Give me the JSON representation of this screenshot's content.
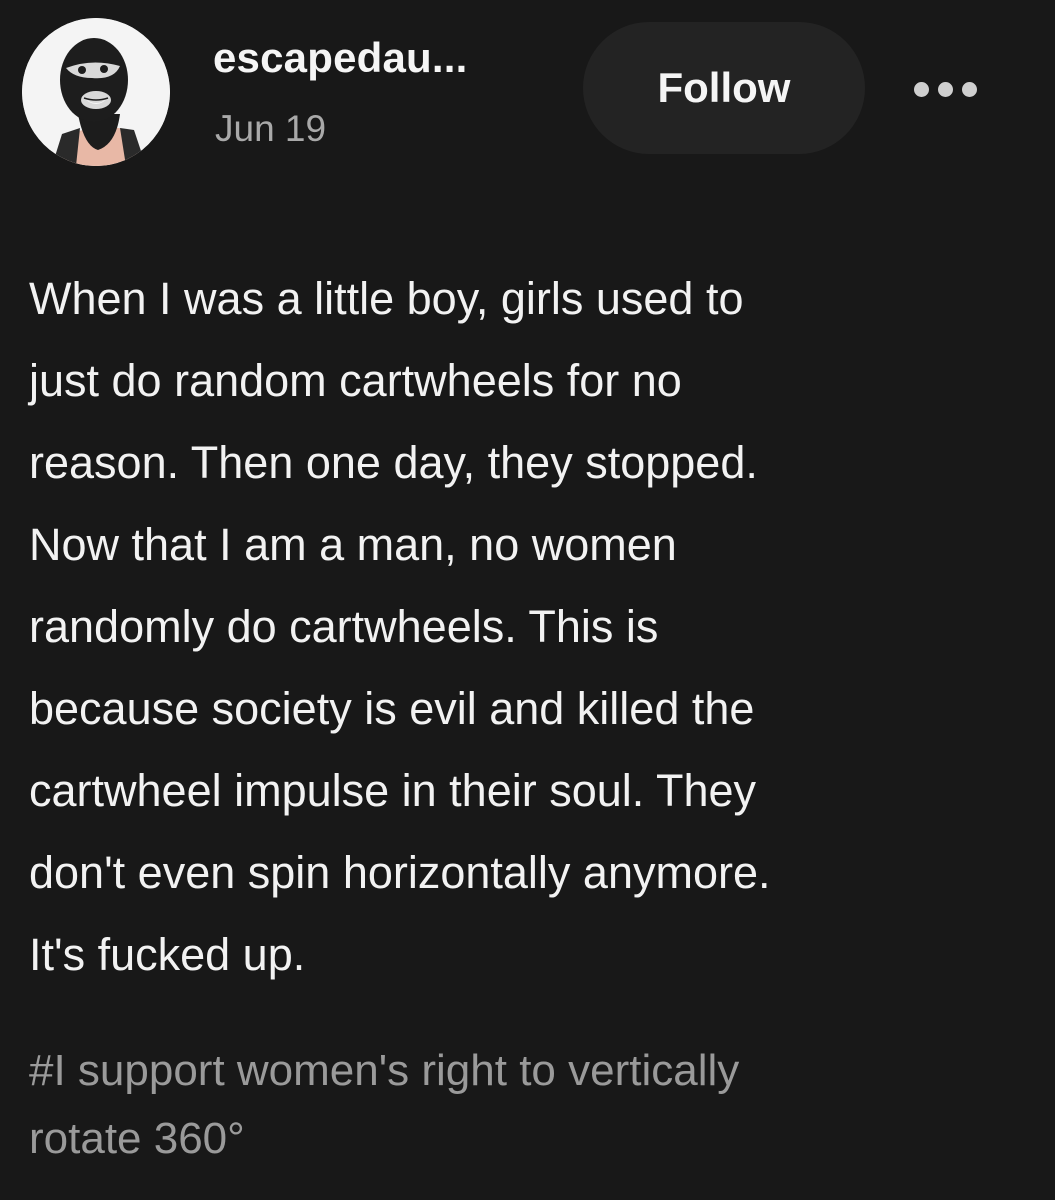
{
  "post": {
    "username": "escapedau...",
    "date": "Jun 19",
    "follow_label": "Follow",
    "body_lines": [
      "When I was a little boy, girls used to",
      "just do random cartwheels for no",
      "reason. Then one day, they stopped.",
      "Now that I am a man, no women",
      "randomly do cartwheels. This is",
      "because society is evil and killed the",
      "cartwheel impulse in their soul. They",
      "don't even spin horizontally anymore.",
      "It's fucked up."
    ],
    "tag_lines": [
      "#I support women's right to vertically",
      "rotate 360°"
    ]
  },
  "icons": {
    "avatar": "balaclava-avatar-icon",
    "more": "more-options-icon"
  },
  "colors": {
    "background": "#181818",
    "text": "#f2f2f2",
    "secondary_text": "#a9a9a9",
    "tag_text": "#9a9a9a",
    "follow_button_bg": "#232323"
  }
}
